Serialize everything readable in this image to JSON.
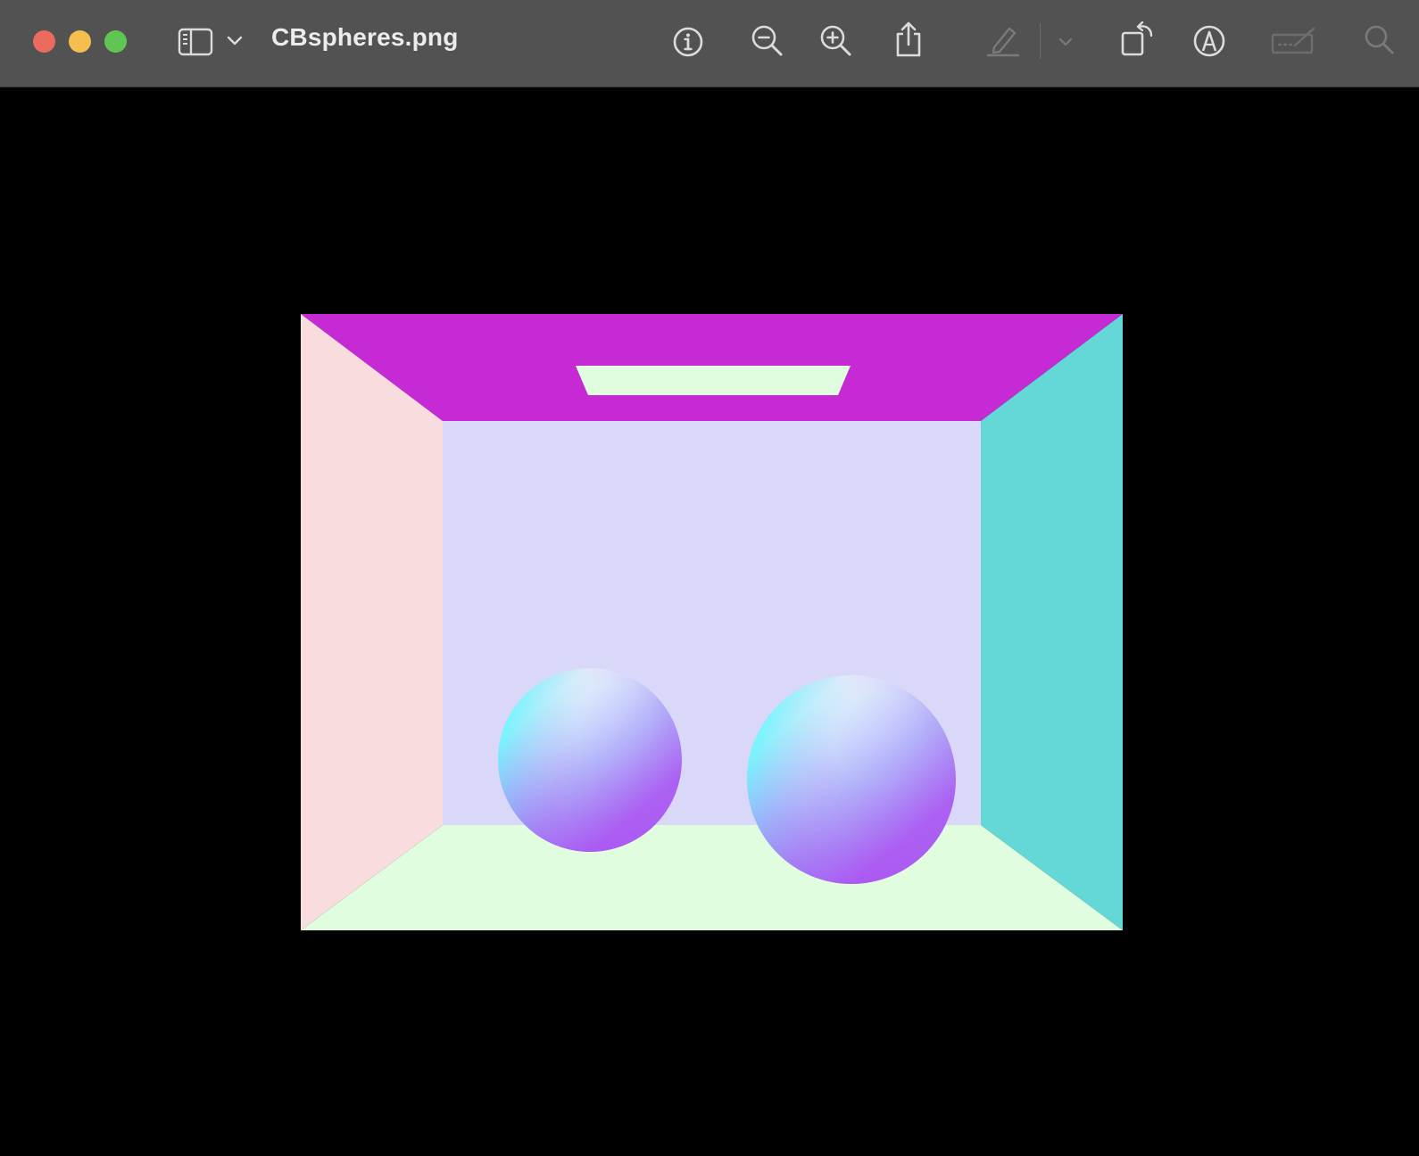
{
  "window": {
    "title": "CBspheres.png"
  },
  "toolbar": {
    "sidebar_toggle_icon": "sidebar-icon",
    "sidebar_menu_icon": "chevron-down-icon",
    "info_icon": "info-icon",
    "zoom_out_icon": "zoom-out-icon",
    "zoom_in_icon": "zoom-in-icon",
    "share_icon": "share-icon",
    "highlight_icon": "pencil-icon",
    "highlight_menu_icon": "chevron-down-icon",
    "rotate_icon": "rotate-icon",
    "markup_icon": "markup-icon",
    "form_fill_icon": "form-fill-icon",
    "search_icon": "search-icon"
  },
  "colors": {
    "titlebar": "#525252",
    "close": "#ed6a5e",
    "minimize": "#f5bf4f",
    "zoom": "#61c554",
    "ceiling": "#c52ad5",
    "ceiling_light": "#e0fde0",
    "left_wall": "#f8dcde",
    "back_wall": "#d9d8f8",
    "right_wall": "#64d7d7",
    "floor": "#e0fde0"
  }
}
